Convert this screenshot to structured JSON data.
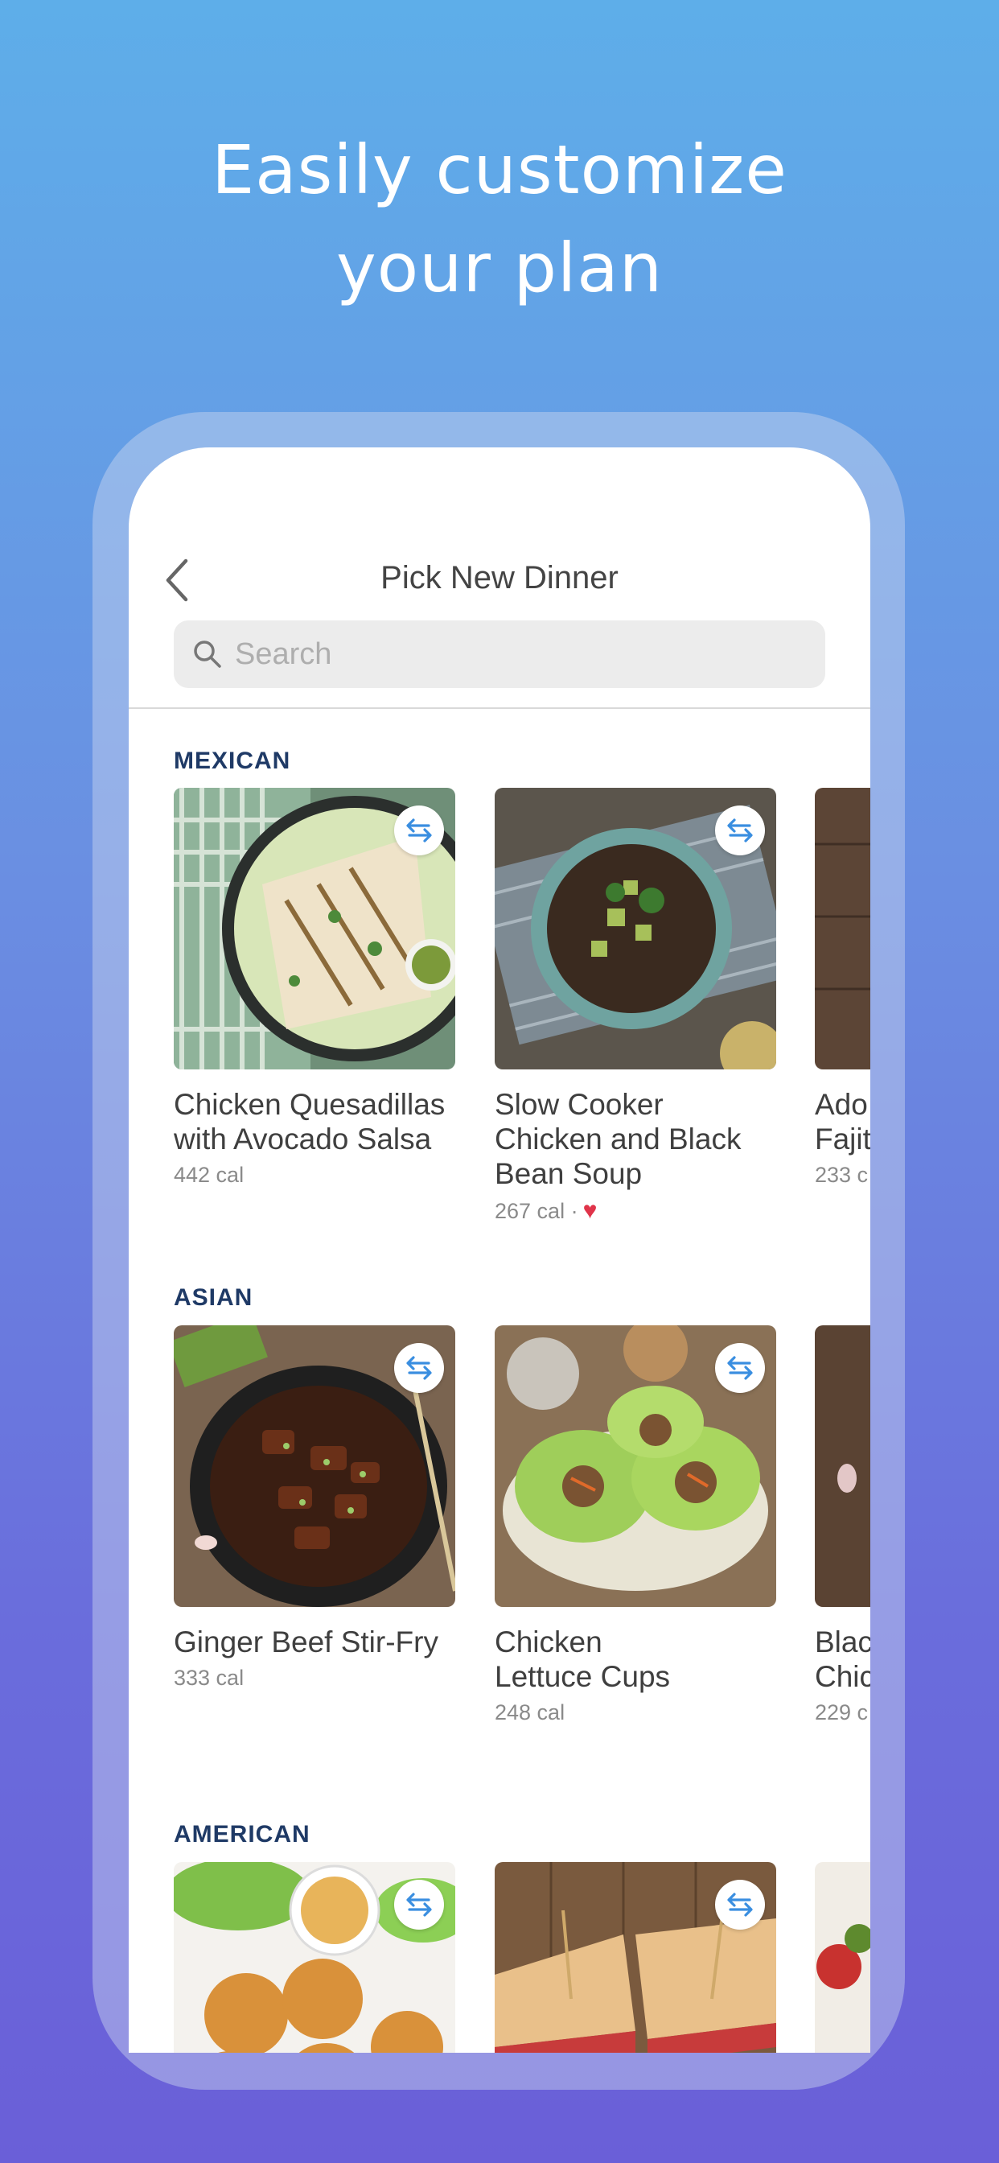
{
  "headline": {
    "line1": "Easily customize",
    "line2": "your plan"
  },
  "nav": {
    "title": "Pick New Dinner"
  },
  "search": {
    "placeholder": "Search"
  },
  "sections": [
    {
      "title": "MEXICAN",
      "cards": [
        {
          "name": "Chicken Quesadillas\nwith Avocado Salsa",
          "cal": "442 cal"
        },
        {
          "name": "Slow Cooker\nChicken and Black\nBean Soup",
          "cal": "267 cal ·"
        },
        {
          "name": "Ado\nFajit",
          "cal": "233 c"
        }
      ]
    },
    {
      "title": "ASIAN",
      "cards": [
        {
          "name": "Ginger Beef Stir-Fry",
          "cal": "333 cal"
        },
        {
          "name": "Chicken\nLettuce Cups",
          "cal": "248 cal"
        },
        {
          "name": "Blac\nChic",
          "cal": "229 c"
        }
      ]
    },
    {
      "title": "AMERICAN",
      "cards": []
    }
  ],
  "colors": {
    "section_title": "#1f3a66",
    "swap_icon": "#3a8ee0",
    "heart": "#e0344a"
  },
  "icons": {
    "back": "chevron-left-icon",
    "search": "search-icon",
    "swap": "swap-arrows-icon",
    "favorite": "heart-icon"
  }
}
